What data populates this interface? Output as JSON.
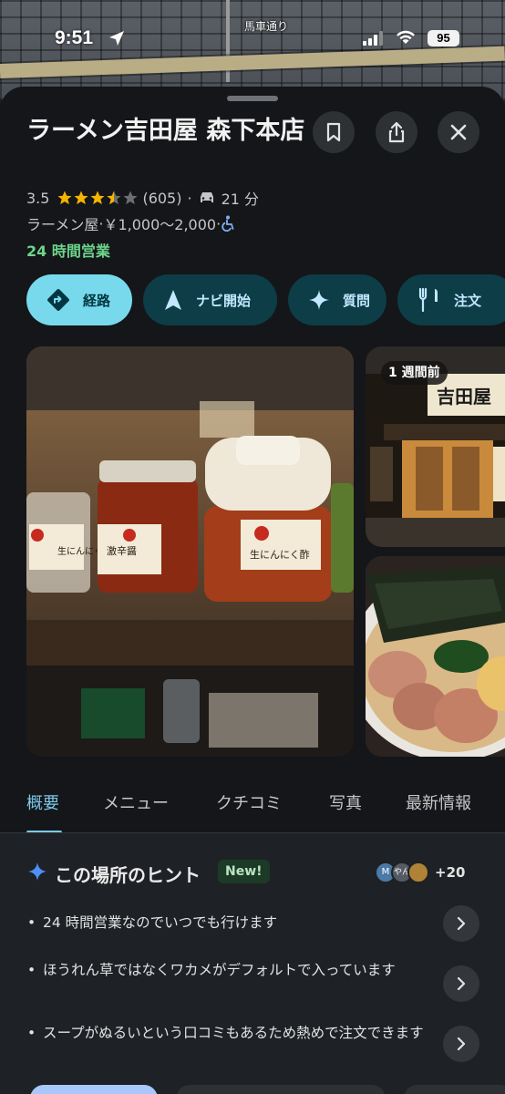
{
  "map": {
    "street_label": "馬車通り"
  },
  "status": {
    "time": "9:51",
    "battery": "95"
  },
  "place": {
    "name": "ラーメン吉田屋 森下本店",
    "rating": "3.5",
    "review_count": "(605)",
    "drive_time": "21 分",
    "category": "ラーメン屋",
    "price": "￥1,000～2,000",
    "hours": "24 時間営業",
    "stars_filled": 3.5
  },
  "actions": {
    "route": "経路",
    "navigate": "ナビ開始",
    "ask": "質問",
    "order": "注文"
  },
  "photos": {
    "main_label_left": "生にんにく",
    "main_label_mid": "激辛醤",
    "main_label_right": "生にんにく酢",
    "store_badge": "1 週間前",
    "store_sign": "吉田屋"
  },
  "tabs": [
    "概要",
    "メニュー",
    "クチコミ",
    "写真",
    "最新情報"
  ],
  "hints": {
    "title": "この場所のヒント",
    "new_badge": "New!",
    "avatar_initial": "M",
    "avatar_2": "やん",
    "contributors_more": "+20",
    "items": [
      "24 時間営業なのでいつでも行けます",
      "ほうれん草ではなくワカメがデフォルトで入っています",
      "スープがぬるいという口コミもあるため熱めで注文できます"
    ]
  },
  "colors": {
    "accent_route": "#78d9ec",
    "chip_bg": "#0d3d47",
    "open_green": "#6dd58c",
    "tab_active": "#7cc7e6",
    "star": "#f4b400"
  }
}
